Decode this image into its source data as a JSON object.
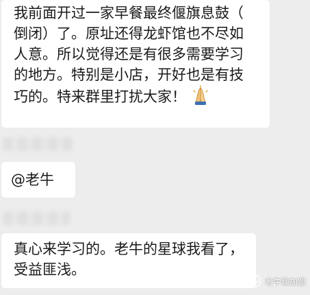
{
  "messages": [
    {
      "lines": [
        "我前面开过一家早餐最终偃旗息鼓（",
        "倒闭）了。原址还得龙虾馆也不尽如",
        "人意。所以觉得还是有很多需要学习",
        "的地方。特别是小店，开好也是有技",
        "巧的。特来群里打扰大家！"
      ],
      "emoji": "folded-hands"
    },
    {
      "text": "@老牛"
    },
    {
      "lines": [
        "真心来学习的。老牛的星球我看了，",
        "受益匪浅。"
      ]
    }
  ],
  "watermark": {
    "text": "老牛聊加盟",
    "icon": "wechat-channel-icon"
  }
}
